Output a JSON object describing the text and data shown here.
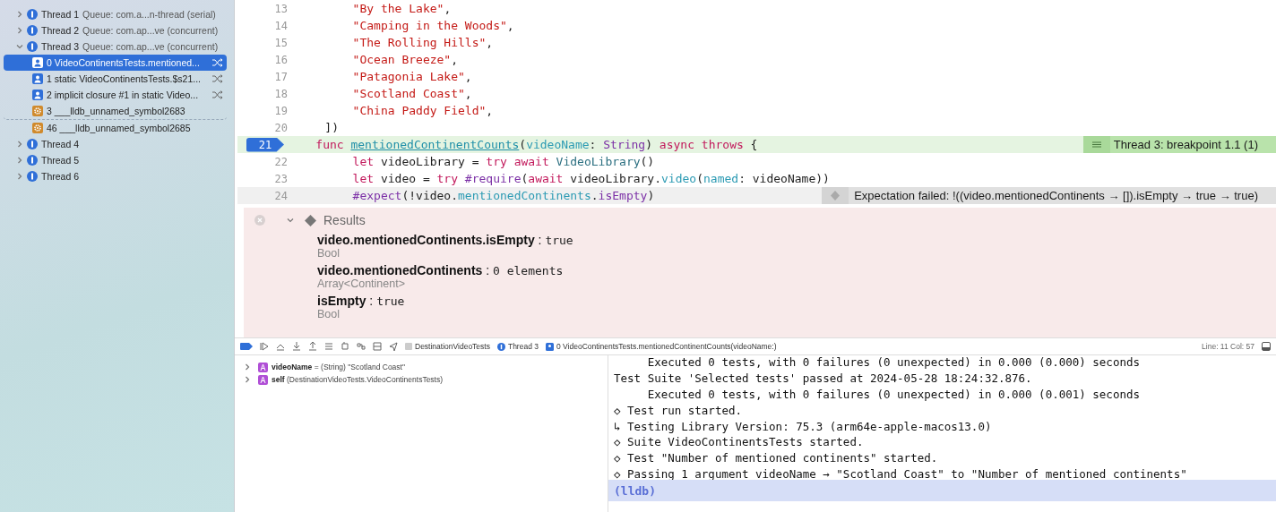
{
  "sidebar": {
    "threads": [
      {
        "label": "Thread 1",
        "queue": "Queue: com.a...n-thread (serial)",
        "expanded": false
      },
      {
        "label": "Thread 2",
        "queue": "Queue: com.ap...ve (concurrent)",
        "expanded": false
      },
      {
        "label": "Thread 3",
        "queue": "Queue: com.ap...ve (concurrent)",
        "expanded": true,
        "frames": [
          {
            "label": "0 VideoContinentsTests.mentioned...",
            "kind": "user",
            "selected": true
          },
          {
            "label": "1 static VideoContinentsTests.$s21...",
            "kind": "user",
            "selected": false
          },
          {
            "label": "2 implicit closure #1 in static Video...",
            "kind": "user",
            "selected": false
          },
          {
            "label": "3 ___lldb_unnamed_symbol2683",
            "kind": "system",
            "selected": false
          },
          {
            "label": "46 ___lldb_unnamed_symbol2685",
            "kind": "system",
            "selected": false
          }
        ]
      },
      {
        "label": "Thread 4",
        "expanded": false
      },
      {
        "label": "Thread 5",
        "expanded": false
      },
      {
        "label": "Thread 6",
        "expanded": false
      }
    ]
  },
  "editor": {
    "lines": [
      {
        "number": "13",
        "current": false,
        "tokens": [
          {
            "kind": "string",
            "t": "        \"By the Lake\""
          },
          {
            "t": ","
          }
        ]
      },
      {
        "number": "14",
        "current": false,
        "tokens": [
          {
            "kind": "string",
            "t": "        \"Camping in the Woods\""
          },
          {
            "t": ","
          }
        ]
      },
      {
        "number": "15",
        "current": false,
        "tokens": [
          {
            "kind": "string",
            "t": "        \"The Rolling Hills\""
          },
          {
            "t": ","
          }
        ]
      },
      {
        "number": "16",
        "current": false,
        "tokens": [
          {
            "kind": "string",
            "t": "        \"Ocean Breeze\""
          },
          {
            "t": ","
          }
        ]
      },
      {
        "number": "17",
        "current": false,
        "tokens": [
          {
            "kind": "string",
            "t": "        \"Patagonia Lake\""
          },
          {
            "t": ","
          }
        ]
      },
      {
        "number": "18",
        "current": false,
        "tokens": [
          {
            "kind": "string",
            "t": "        \"Scotland Coast\""
          },
          {
            "t": ","
          }
        ]
      },
      {
        "number": "19",
        "current": false,
        "tokens": [
          {
            "kind": "string",
            "t": "        \"China Paddy Field\""
          },
          {
            "t": ","
          }
        ]
      },
      {
        "number": "20",
        "current": false,
        "tokens": [
          {
            "t": "    ])"
          }
        ]
      },
      {
        "number": "21",
        "current": true,
        "annotation": {
          "kind": "breakpoint",
          "text": "Thread 3: breakpoint 1.1 (1)"
        },
        "tokens": [
          {
            "kind": "keyword",
            "t": "    func "
          },
          {
            "kind": "decl",
            "t": "mentionedContinentCounts"
          },
          {
            "t": "("
          },
          {
            "kind": "member",
            "t": "videoName"
          },
          {
            "t": ": "
          },
          {
            "kind": "type",
            "t": "String"
          },
          {
            "t": ") "
          },
          {
            "kind": "keyword",
            "t": "async throws"
          },
          {
            "t": " {"
          }
        ]
      },
      {
        "number": "22",
        "current": false,
        "tokens": [
          {
            "kind": "keyword",
            "t": "        let"
          },
          {
            "t": " videoLibrary = "
          },
          {
            "kind": "keyword",
            "t": "try await "
          },
          {
            "kind": "class",
            "t": "VideoLibrary"
          },
          {
            "t": "()"
          }
        ]
      },
      {
        "number": "23",
        "current": false,
        "tokens": [
          {
            "kind": "keyword",
            "t": "        let"
          },
          {
            "t": " video = "
          },
          {
            "kind": "keyword",
            "t": "try "
          },
          {
            "kind": "type",
            "t": "#require"
          },
          {
            "t": "("
          },
          {
            "kind": "keyword",
            "t": "await"
          },
          {
            "t": " videoLibrary."
          },
          {
            "kind": "member",
            "t": "video"
          },
          {
            "t": "("
          },
          {
            "kind": "member",
            "t": "named"
          },
          {
            "t": ": videoName))"
          }
        ]
      },
      {
        "number": "24",
        "current": false,
        "annotation": {
          "kind": "failure",
          "text": "Expectation failed: !((video.mentionedContinents → []).isEmpty → true → true)"
        },
        "tokens": [
          {
            "kind": "type",
            "t": "        #expect"
          },
          {
            "t": "(!video."
          },
          {
            "kind": "member",
            "t": "mentionedContinents"
          },
          {
            "t": "."
          },
          {
            "kind": "type",
            "t": "isEmpty"
          },
          {
            "t": ")"
          }
        ]
      }
    ],
    "results": {
      "title": "Results",
      "expanded": true,
      "items": [
        {
          "name": "video.mentionedContinents.isEmpty",
          "separator": ":",
          "value": "true",
          "type": "Bool"
        },
        {
          "name": "video.mentionedContinents",
          "separator": ":",
          "value": "0 elements",
          "type": "Array<Continent>"
        },
        {
          "name": "isEmpty",
          "separator": ":",
          "value": "true",
          "type": "Bool"
        }
      ]
    }
  },
  "debug_bar": {
    "breadcrumbs": [
      "DestinationVideoTests",
      "Thread 3",
      "0 VideoContinentsTests.mentionedContinentCounts(videoName:)"
    ],
    "position": "Line: 11  Col: 57"
  },
  "variables": [
    {
      "name": "videoName",
      "detail": "= (String) \"Scotland Coast\""
    },
    {
      "name": "self",
      "detail": "(DestinationVideoTests.VideoContinentsTests)"
    }
  ],
  "console": {
    "lines": [
      "     Executed 0 tests, with 0 failures (0 unexpected) in 0.000 (0.000) seconds",
      "Test Suite 'Selected tests' passed at 2024-05-28 18:24:32.876.",
      "     Executed 0 tests, with 0 failures (0 unexpected) in 0.000 (0.001) seconds",
      "◇ Test run started.",
      "↳ Testing Library Version: 75.3 (arm64e-apple-macos13.0)",
      "◇ Suite VideoContinentsTests started.",
      "◇ Test \"Number of mentioned continents\" started.",
      "◇ Passing 1 argument videoName → \"Scotland Coast\" to \"Number of mentioned continents\""
    ],
    "prompt": "(lldb)"
  }
}
